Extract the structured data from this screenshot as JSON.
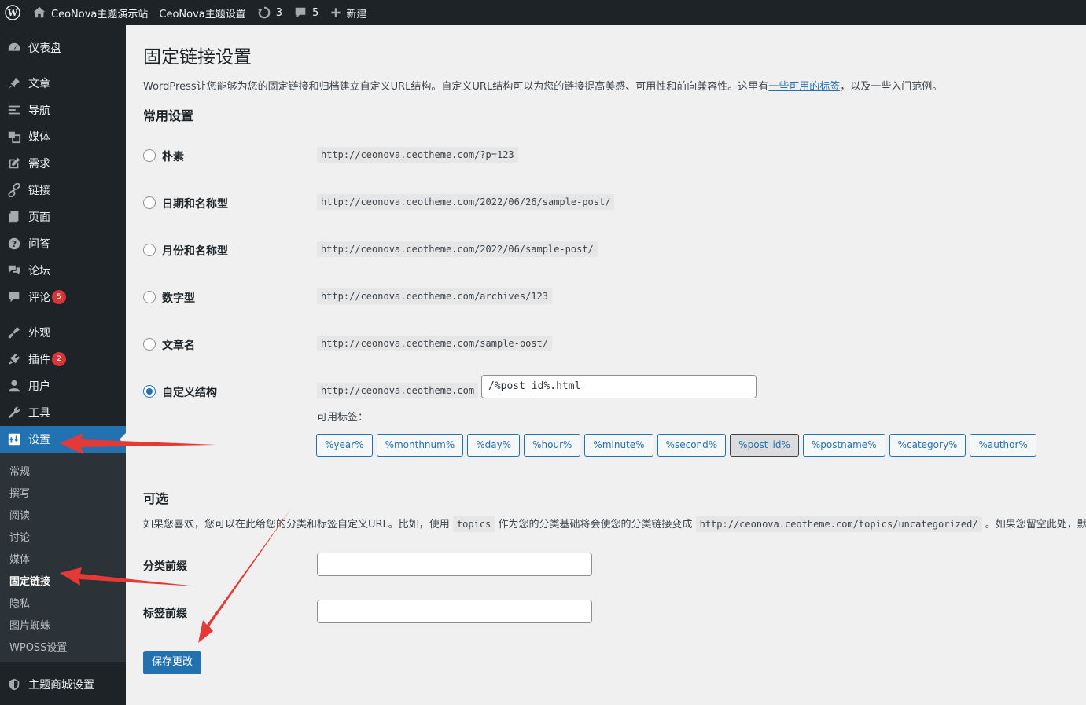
{
  "adminbar": {
    "site_name": "CeoNova主题演示站",
    "theme_settings": "CeoNova主题设置",
    "updates_count": "3",
    "comments_count": "5",
    "new_label": "新建"
  },
  "sidebar": {
    "items": [
      {
        "label": "仪表盘",
        "icon": "dashboard-icon"
      },
      {
        "label": "文章",
        "icon": "pushpin-icon"
      },
      {
        "label": "导航",
        "icon": "menu-lines-icon"
      },
      {
        "label": "媒体",
        "icon": "media-icon"
      },
      {
        "label": "需求",
        "icon": "edit-icon"
      },
      {
        "label": "链接",
        "icon": "link-icon"
      },
      {
        "label": "页面",
        "icon": "page-icon"
      },
      {
        "label": "问答",
        "icon": "question-icon"
      },
      {
        "label": "论坛",
        "icon": "forum-icon"
      },
      {
        "label": "评论",
        "icon": "comment-icon",
        "badge": "5"
      },
      {
        "label": "外观",
        "icon": "appearance-icon"
      },
      {
        "label": "插件",
        "icon": "plugin-icon",
        "badge": "2"
      },
      {
        "label": "用户",
        "icon": "user-icon"
      },
      {
        "label": "工具",
        "icon": "wrench-icon"
      },
      {
        "label": "设置",
        "icon": "settings-icon"
      },
      {
        "label": "主题商城设置",
        "icon": "shield-icon"
      }
    ],
    "submenu": [
      "常规",
      "撰写",
      "阅读",
      "讨论",
      "媒体",
      "固定链接",
      "隐私",
      "图片蜘蛛",
      "WPOSS设置"
    ]
  },
  "page": {
    "title": "固定链接设置",
    "intro_before": "WordPress让您能够为您的固定链接和归档建立自定义URL结构。自定义URL结构可以为您的链接提高美感、可用性和前向兼容性。这里有",
    "intro_link": "一些可用的标签",
    "intro_after": "，以及一些入门范例。",
    "common_title": "常用设置",
    "options": [
      {
        "label": "朴素",
        "example": "http://ceonova.ceotheme.com/?p=123",
        "checked": false
      },
      {
        "label": "日期和名称型",
        "example": "http://ceonova.ceotheme.com/2022/06/26/sample-post/",
        "checked": false
      },
      {
        "label": "月份和名称型",
        "example": "http://ceonova.ceotheme.com/2022/06/sample-post/",
        "checked": false
      },
      {
        "label": "数字型",
        "example": "http://ceonova.ceotheme.com/archives/123",
        "checked": false
      },
      {
        "label": "文章名",
        "example": "http://ceonova.ceotheme.com/sample-post/",
        "checked": false
      },
      {
        "label": "自定义结构",
        "example": "http://ceonova.ceotheme.com",
        "checked": true
      }
    ],
    "custom_value": "/%post_id%.html",
    "available_tags_label": "可用标签：",
    "tags": [
      "%year%",
      "%monthnum%",
      "%day%",
      "%hour%",
      "%minute%",
      "%second%",
      "%post_id%",
      "%postname%",
      "%category%",
      "%author%"
    ],
    "active_tag": "%post_id%",
    "optional_title": "可选",
    "optional_desc_1": "如果您喜欢，您可以在此给您的分类和标签自定义URL。比如，使用",
    "optional_code_1": "topics",
    "optional_desc_2": "作为您的分类基础将会使您的分类链接变成",
    "optional_code_2": "http://ceonova.ceotheme.com/topics/uncategorized/",
    "optional_desc_3": "。如果您留空此处，默认值",
    "category_base_label": "分类前缀",
    "tag_base_label": "标签前缀",
    "category_base_value": "",
    "tag_base_value": "",
    "save_label": "保存更改"
  },
  "colors": {
    "accent": "#2271b1",
    "sidebar_bg": "#1d2327",
    "arrow": "#e53935"
  }
}
